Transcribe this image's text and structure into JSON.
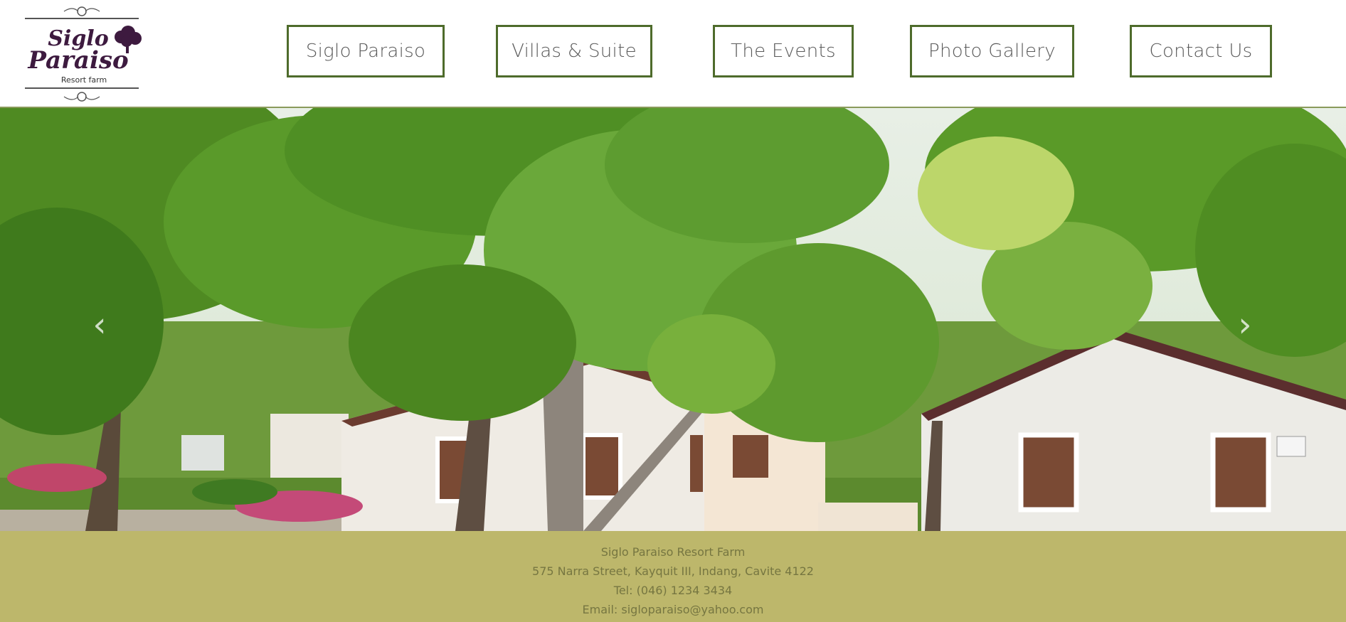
{
  "logo": {
    "name_line1": "Siglo",
    "name_line2": "Paraiso",
    "tagline": "Resort farm"
  },
  "nav": {
    "items": [
      {
        "label": "Siglo Paraiso"
      },
      {
        "label": "Villas & Suite"
      },
      {
        "label": "The Events"
      },
      {
        "label": "Photo Gallery"
      },
      {
        "label": "Contact Us"
      }
    ]
  },
  "hero": {
    "prev_icon": "chevron-left-icon",
    "next_icon": "chevron-right-icon",
    "prev_glyph": "‹",
    "next_glyph": "›"
  },
  "footer": {
    "name": "Siglo Paraiso Resort Farm",
    "address": "575 Narra Street, Kayquit III, Indang, Cavite 4122",
    "tel": "Tel: (046) 1234 3434",
    "email": "Email: sigloparaiso@yahoo.com"
  },
  "colors": {
    "nav_border": "#4e6b2b",
    "footer_bg": "#bdb76b",
    "footer_text": "#767641",
    "logo_purple": "#3d1a3f"
  }
}
